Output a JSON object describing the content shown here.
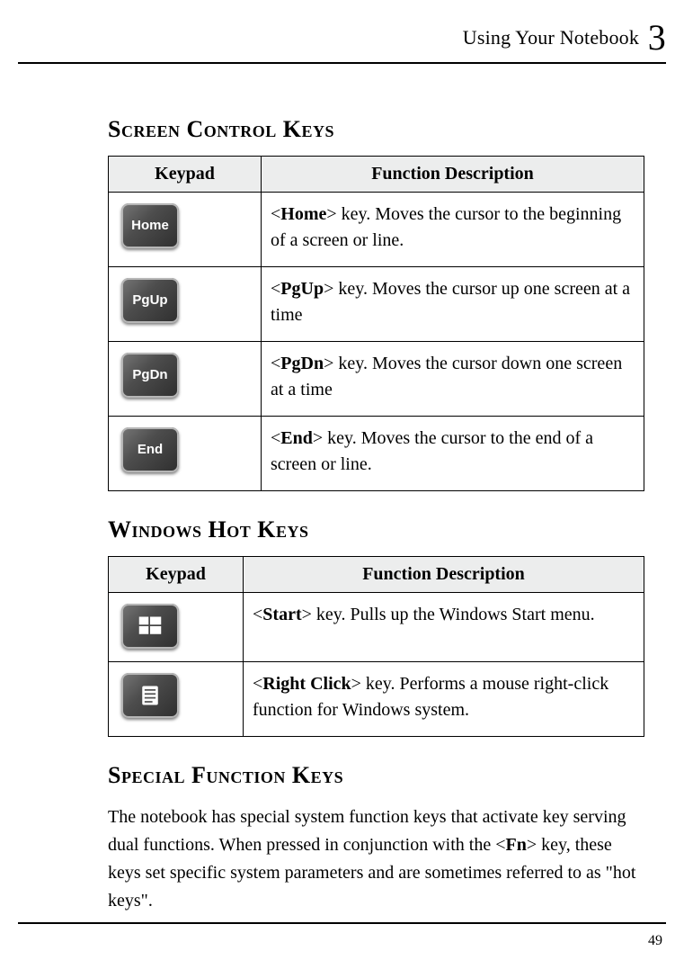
{
  "header": {
    "title": "Using Your Notebook",
    "chapter": "3"
  },
  "page_number": "49",
  "table_headers": {
    "keypad": "Keypad",
    "function": "Function Description"
  },
  "sections": {
    "screen": {
      "title": "Screen Control Keys",
      "rows": [
        {
          "key_label": "Home",
          "key_name": "Home",
          "desc_rest": " key. Moves the cursor to the beginning of a screen or line."
        },
        {
          "key_label": "PgUp",
          "key_name": "PgUp",
          "desc_rest": " key. Moves the cursor up one screen at a time"
        },
        {
          "key_label": "PgDn",
          "key_name": "PgDn",
          "desc_rest": " key. Moves the cursor down one screen at a time"
        },
        {
          "key_label": "End",
          "key_name": "End",
          "desc_rest": " key. Moves the cursor to the end of a screen or line."
        }
      ]
    },
    "windows": {
      "title": "Windows Hot Keys",
      "rows": [
        {
          "key_icon": "windows-logo",
          "key_name": "Start",
          "desc_rest": " key. Pulls up the Windows Start menu."
        },
        {
          "key_icon": "context-menu",
          "key_name": "Right Click",
          "desc_rest": " key. Performs a mouse right-click function for Windows system."
        }
      ]
    },
    "special": {
      "title": "Special Function Keys",
      "body_pre": "The notebook has special system function keys that activate key serving dual functions. When pressed in conjunction with the <",
      "body_key": "Fn",
      "body_post": "> key, these keys set specific system parameters and are sometimes referred to as \"hot keys\"."
    }
  }
}
